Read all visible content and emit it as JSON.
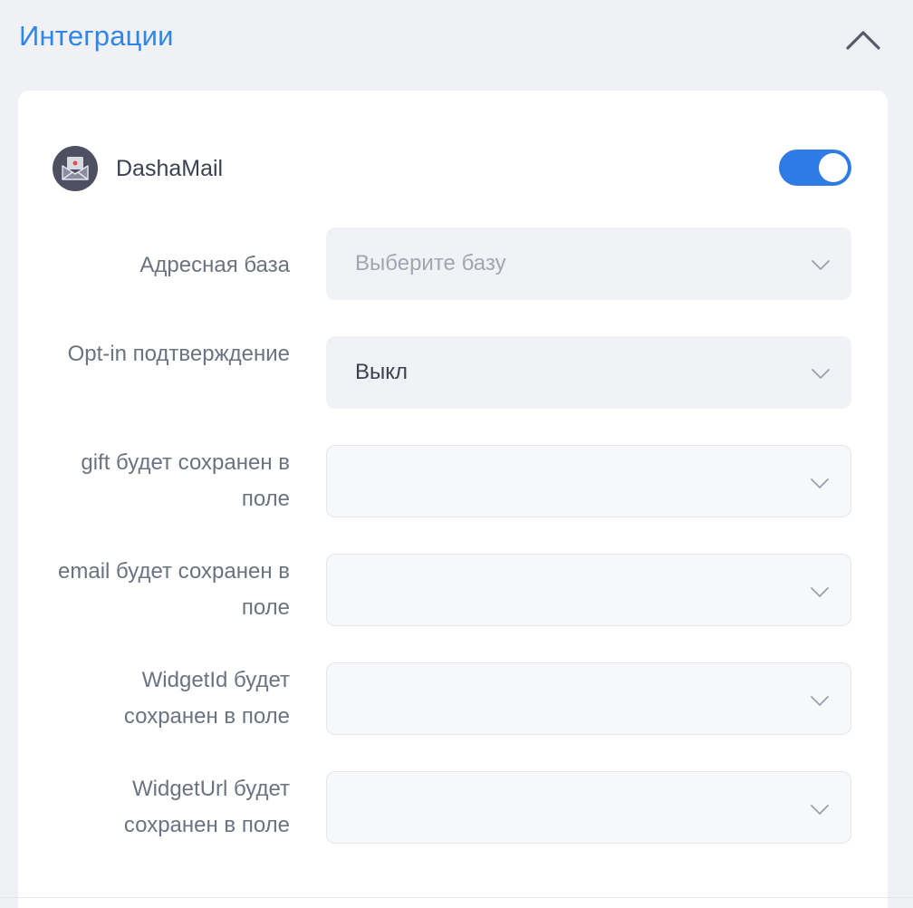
{
  "section": {
    "title": "Интеграции",
    "collapse_icon": "chevron-up-icon"
  },
  "integration": {
    "name": "DashaMail",
    "icon": "envelope-icon",
    "enabled": true,
    "toggle_color": "#2f7be5"
  },
  "fields": [
    {
      "label": "Адресная база",
      "value": "",
      "placeholder": "Выберите базу"
    },
    {
      "label": "Opt-in подтверждение",
      "value": "Выкл",
      "placeholder": ""
    },
    {
      "label": "gift будет сохранен в поле",
      "value": "",
      "placeholder": ""
    },
    {
      "label": "email будет сохранен в поле",
      "value": "",
      "placeholder": ""
    },
    {
      "label": "WidgetId будет сохранен в поле",
      "value": "",
      "placeholder": ""
    },
    {
      "label": "WidgetUrl будет сохранен в поле",
      "value": "",
      "placeholder": ""
    }
  ],
  "colors": {
    "accent": "#2f86e6",
    "background": "#eff1f5",
    "card": "#ffffff"
  }
}
